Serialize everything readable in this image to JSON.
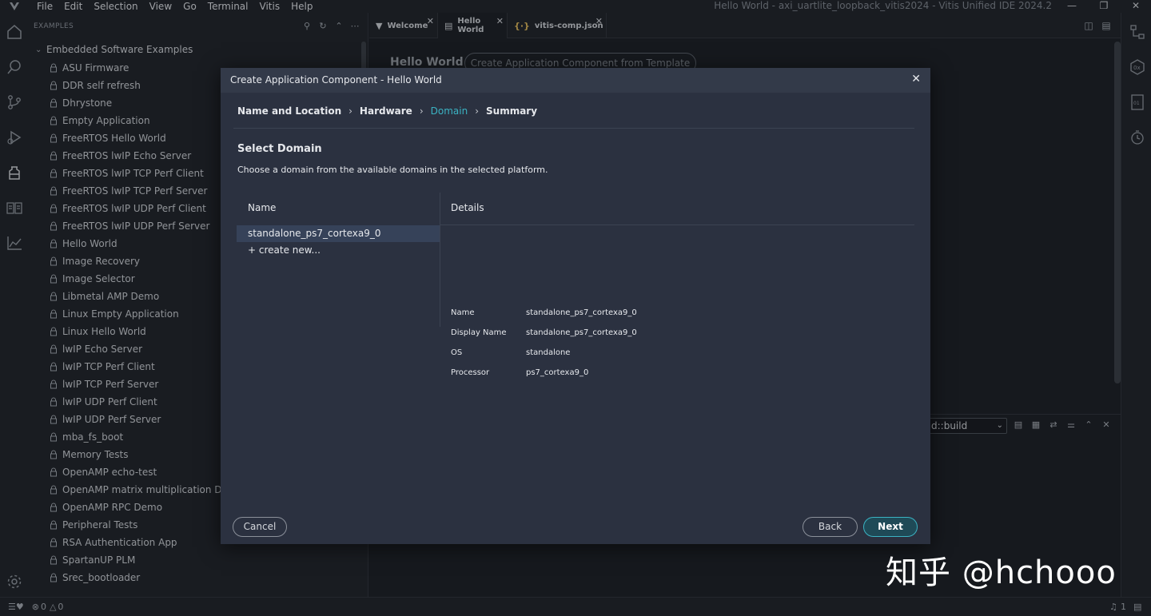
{
  "menubar": {
    "items": [
      "File",
      "Edit",
      "Selection",
      "View",
      "Go",
      "Terminal",
      "Vitis",
      "Help"
    ],
    "window_title": "Hello World - axi_uartlite_loopback_vitis2024 - Vitis Unified IDE 2024.2"
  },
  "sidebar": {
    "title": "EXAMPLES",
    "root_label": "Embedded Software Examples",
    "items": [
      "ASU Firmware",
      "DDR self refresh",
      "Dhrystone",
      "Empty Application",
      "FreeRTOS Hello World",
      "FreeRTOS lwIP Echo Server",
      "FreeRTOS lwIP TCP Perf Client",
      "FreeRTOS lwIP TCP Perf Server",
      "FreeRTOS lwIP UDP Perf Client",
      "FreeRTOS lwIP UDP Perf Server",
      "Hello World",
      "Image Recovery",
      "Image Selector",
      "Libmetal AMP Demo",
      "Linux Empty Application",
      "Linux Hello World",
      "lwIP Echo Server",
      "lwIP TCP Perf Client",
      "lwIP TCP Perf Server",
      "lwIP UDP Perf Client",
      "lwIP UDP Perf Server",
      "mba_fs_boot",
      "Memory Tests",
      "OpenAMP echo-test",
      "OpenAMP matrix multiplication Demo",
      "OpenAMP RPC Demo",
      "Peripheral Tests",
      "RSA Authentication App",
      "SpartanUP PLM",
      "Srec_bootloader"
    ]
  },
  "tabs": [
    {
      "label": "Welcome",
      "icon": "vitis-logo-icon"
    },
    {
      "label": "Hello World",
      "icon": "lock-icon"
    },
    {
      "label": "vitis-comp.json",
      "icon": "json-braces-icon"
    }
  ],
  "editor": {
    "title": "Hello World",
    "template_button": "Create Application Component from Template"
  },
  "panel": {
    "select_value": "d::build"
  },
  "statusbar": {
    "errors": "0",
    "warnings": "0",
    "notifications": "1"
  },
  "dialog": {
    "title": "Create Application Component - Hello World",
    "breadcrumb": [
      "Name and Location",
      "Hardware",
      "Domain",
      "Summary"
    ],
    "current_step": "Domain",
    "section_title": "Select Domain",
    "section_desc": "Choose a domain from the available domains in the selected platform.",
    "name_header": "Name",
    "details_header": "Details",
    "domain": "standalone_ps7_cortexa9_0",
    "create_new": "create new...",
    "details": [
      {
        "label": "Name",
        "value": "standalone_ps7_cortexa9_0"
      },
      {
        "label": "Display Name",
        "value": "standalone_ps7_cortexa9_0"
      },
      {
        "label": "OS",
        "value": "standalone"
      },
      {
        "label": "Processor",
        "value": "ps7_cortexa9_0"
      }
    ],
    "cancel": "Cancel",
    "back": "Back",
    "next": "Next"
  },
  "watermark": "知乎 @hchooo",
  "colors": {
    "accent": "#3bb3c3",
    "dialog_bg": "#2b3140",
    "selected_row": "#364259"
  }
}
